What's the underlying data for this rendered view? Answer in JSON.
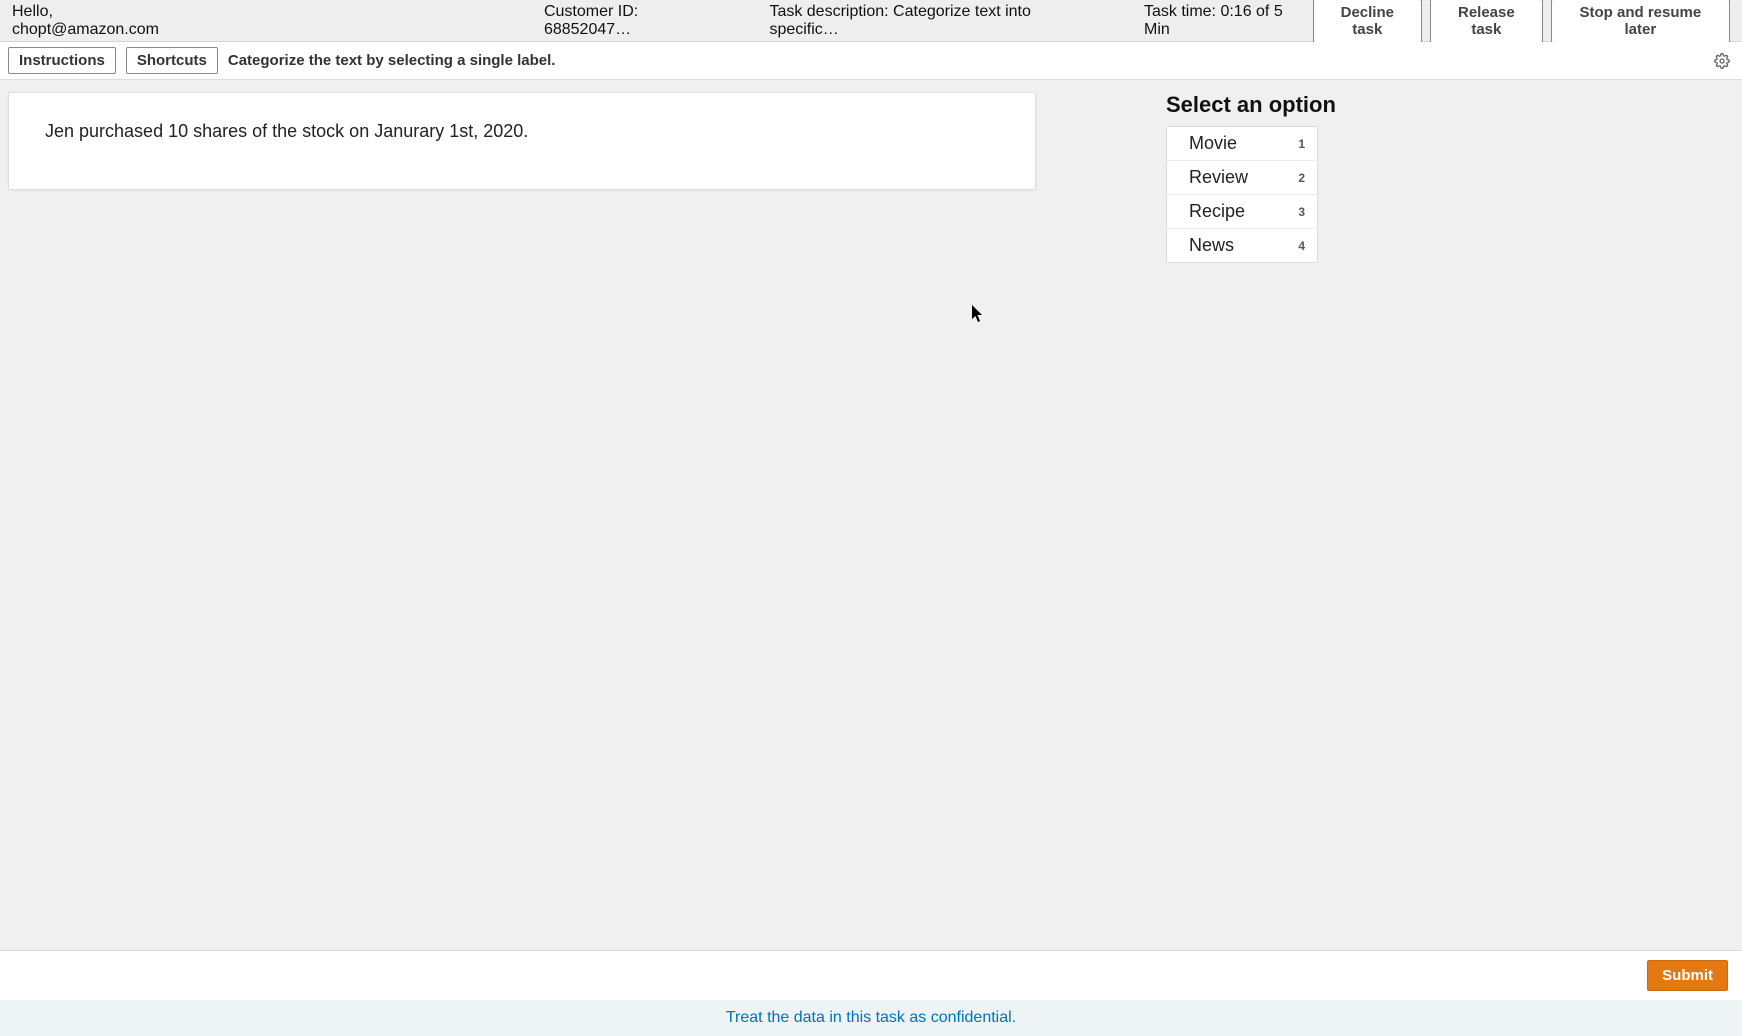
{
  "header": {
    "greeting": "Hello, chopt@amazon.com",
    "customer_id": "Customer ID: 68852047…",
    "task_desc": "Task description: Categorize text into specific…",
    "task_time": "Task time: 0:16 of 5 Min",
    "decline_label": "Decline task",
    "release_label": "Release task",
    "stop_label": "Stop and resume later"
  },
  "toolbar": {
    "instructions_label": "Instructions",
    "shortcuts_label": "Shortcuts",
    "hint": "Categorize the text by selecting a single label."
  },
  "content": {
    "text": "Jen purchased 10 shares of the stock on Janurary 1st, 2020."
  },
  "options": {
    "title": "Select an option",
    "items": [
      {
        "label": "Movie",
        "shortcut": "1"
      },
      {
        "label": "Review",
        "shortcut": "2"
      },
      {
        "label": "Recipe",
        "shortcut": "3"
      },
      {
        "label": "News",
        "shortcut": "4"
      }
    ]
  },
  "footer": {
    "submit_label": "Submit",
    "confidential": "Treat the data in this task as confidential."
  }
}
